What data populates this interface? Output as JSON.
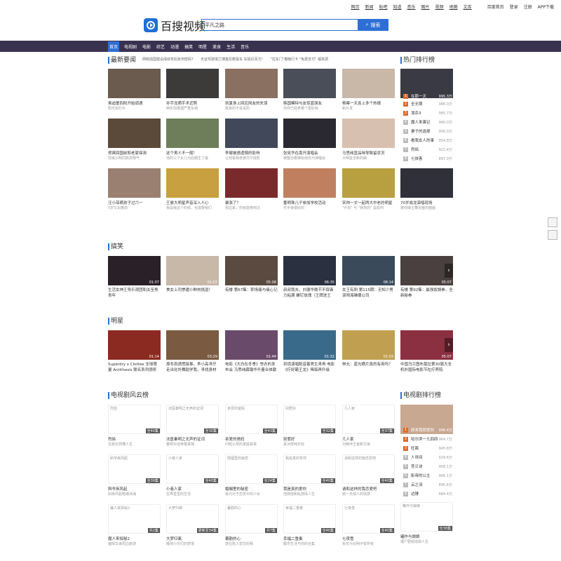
{
  "top_links": [
    "网页",
    "新闻",
    "贴吧",
    "知道",
    "音乐",
    "图片",
    "视频",
    "地图",
    "文库",
    "百度首页",
    "登录",
    "注册",
    "APP下载"
  ],
  "logo": "百搜视频",
  "search": {
    "value": "平凡之路",
    "button": "搜索"
  },
  "nav": [
    "首页",
    "电视剧",
    "电影",
    "综艺",
    "动漫",
    "搞笑",
    "明星",
    "美食",
    "生活",
    "音乐"
  ],
  "sections": {
    "news": "最新要闻",
    "hot": "热门排行榜",
    "funny": "搞笑",
    "star": "明星",
    "tvcloud": "电视剧风云榜",
    "tvrank": "电视剧排行榜"
  },
  "news_links": [
    "网络强国建设成绩背后有何密码？",
    "无证驾驶撞兰博基尼赔毫车 车损近百万！",
    "\"拉车门\"春晚行卡 \"免费支付\" 或高调"
  ],
  "news_items": [
    {
      "t": "奥迪童四阳开始调遇",
      "s": "阳光如灯片"
    },
    {
      "t": "孙宇龙晒手术近照",
      "s": "两年前遭遇严重车祸"
    },
    {
      "t": "凯夏身上回应网友的失误",
      "s": "我真的不是说的"
    },
    {
      "t": "韩国模特与友惊蓝朋友",
      "s": "你你已经拿着个更好有"
    },
    {
      "t": "杨幂一天连上多个热搜",
      "s": "新片发"
    },
    {
      "t": "郑爽回国前和老家探测",
      "s": "思域小明同款高物气"
    },
    {
      "t": "这个男人不一般！",
      "s": "他的三个女儿为后期生了最"
    },
    {
      "t": "李健被遇遗憾的影响",
      "s": "让观看我老婆打印成影"
    },
    {
      "t": "张宪华在南开演唱会",
      "s": "被整治着嫁给他仅为演唱会"
    },
    {
      "t": "马思纯宣品味导致留状况",
      "s": "大明星全新的曲"
    },
    {
      "t": "汪小菲晒孩子过六一",
      "s": "5岁又出着前"
    },
    {
      "t": "王晏大明星声音深入人心",
      "s": "我是我这个时候，也需要我们"
    },
    {
      "t": "聚涨了？",
      "s": "周边来，你有能够到达"
    },
    {
      "t": "董明珠儿子参加学校活动",
      "s": "可手得很好的"
    },
    {
      "t": "宋帅一文一起两大中老的明星",
      "s": "\"中央\" 与 \"我党的\" 是如何"
    },
    {
      "t": "70岁成龙演唱现场",
      "s": "被你嫁主舞完整的面面"
    }
  ],
  "hot_rank": [
    {
      "n": "1",
      "t": "在那一天",
      "v": "995.3万"
    },
    {
      "n": "2",
      "t": "全无罪",
      "v": "986.0万"
    },
    {
      "n": "3",
      "t": "误杀3",
      "v": "985.7万"
    },
    {
      "n": "4",
      "t": "魔人来袭记",
      "v": "960.0万"
    },
    {
      "n": "5",
      "t": "妻子的选择",
      "v": "956.0万"
    },
    {
      "n": "6",
      "t": "看我女人的事",
      "v": "954.8万"
    },
    {
      "n": "7",
      "t": "烈焰",
      "v": "922.4万"
    },
    {
      "n": "8",
      "t": "七侠客",
      "v": "897.0万"
    }
  ],
  "funny": [
    {
      "t": "生活女神王导乐观团和关至男青年",
      "d": "01:07"
    },
    {
      "t": "美女上司惨遭小鲜肉挑逗！",
      "d": "01:07"
    },
    {
      "t": "有楼 第67集：职场痛与痛心记",
      "d": "05:08"
    },
    {
      "t": "叔叔我去，刘德华晚节不保奋力粘满 螺钉玫瑰（王牌进王",
      "d": "06:35"
    },
    {
      "t": "女王有刺 第115期：无知少男误闯海琳娜公司",
      "d": "08:14"
    },
    {
      "t": "有楼 第92集：最强饭锅拳，全新秘拳",
      "d": "05:07"
    }
  ],
  "star": [
    {
      "t": "Superdry x Clottee 全球限量 Antithesis 联名系列颁奖",
      "d": "01:14"
    },
    {
      "t": "周冬雨遇慌接事，李小高寻仔走出化外舞蹈学我，寻找身材",
      "d": "03:29"
    },
    {
      "t": "电影《大白在冬季》举办的发布会 马思纯薛璐华升量合体献",
      "d": "01:44"
    },
    {
      "t": "到现演唱配音着男生来再 电影《疗好霸王龙》降临再升级",
      "d": "01:32"
    },
    {
      "t": "林允：蓝光横片真的有用吗？",
      "d": "01:03"
    },
    {
      "t": "中国乌兰图布莫拉第30届大全机外国际电影节在疗养院",
      "d": "05:07"
    }
  ],
  "tvcloud": [
    {
      "t": "烈焰",
      "s": "任嘉伦周懂人生",
      "e": "全40集"
    },
    {
      "t": "法医秦明之无声的证词",
      "s": "秦明对话骨骼真相",
      "e": "全30集"
    },
    {
      "t": "亲爱的爸妈",
      "s": "问题父母的家庭故事",
      "e": "全43集"
    },
    {
      "t": "别惹好",
      "s": "素冰样纯无双",
      "e": "全32集"
    },
    {
      "t": "几人家",
      "s": "刘峰伴王爸和兄弟",
      "e": "全37集"
    },
    {
      "t": "斜爷疾风起",
      "s": "斜疾风起暗潮汹涌",
      "e": "全39集"
    },
    {
      "t": "小巷人家",
      "s": "在弄堂里的生活",
      "e": "全40集"
    },
    {
      "t": "婚姻里的秘密",
      "s": "良允对于恋爱中的少女",
      "e": "全24集"
    },
    {
      "t": "我是真的爱你",
      "s": "他随他和乱感情人生",
      "e": "全40集"
    },
    {
      "t": "请和这样的我恋爱吧",
      "s": "她一天成人的情感",
      "e": "全40集"
    },
    {
      "t": "魔人来探秘2",
      "s": "魔探华来周边旅游",
      "e": "共2集"
    },
    {
      "t": "大梦归离",
      "s": "缠绵小乐们的梦境",
      "e": "更新至34集"
    },
    {
      "t": "暮勤的心",
      "s": "感在陷入爱恋的我",
      "e": "共7集"
    },
    {
      "t": "幸福二重奏",
      "s": "都市生活与你的合集",
      "e": "全40集"
    },
    {
      "t": "七夜雪",
      "s": "有花为在明中有所有",
      "e": "全40集"
    }
  ],
  "tv_rank": [
    {
      "n": "1",
      "t": "原来我很爱你",
      "v": "996.4万"
    },
    {
      "n": "2",
      "t": "哈尔滨一九四四",
      "v": "964.7万"
    },
    {
      "n": "3",
      "t": "狂飙",
      "v": "945.8万"
    },
    {
      "n": "4",
      "t": "人世间",
      "v": "929.6万"
    },
    {
      "n": "5",
      "t": "苍兰诀",
      "v": "908.1万"
    },
    {
      "n": "6",
      "t": "影帝的公主",
      "v": "906.1万"
    },
    {
      "n": "7",
      "t": "云之羽",
      "v": "895.6万"
    },
    {
      "n": "8",
      "t": "边陲",
      "v": "884.4万"
    },
    {
      "n": "9",
      "t": "罐作与娘娘",
      "v": ""
    }
  ]
}
